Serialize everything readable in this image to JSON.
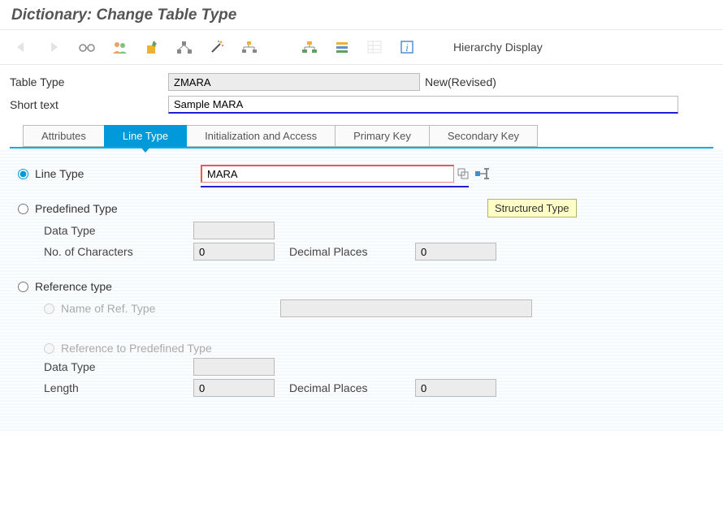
{
  "title": "Dictionary: Change Table Type",
  "toolbar": {
    "hierarchy_label": "Hierarchy Display"
  },
  "header": {
    "table_type_label": "Table Type",
    "table_type_value": "ZMARA",
    "status_text": "New(Revised)",
    "short_text_label": "Short text",
    "short_text_value": "Sample MARA"
  },
  "tabs": {
    "attributes": "Attributes",
    "line_type": "Line Type",
    "init_access": "Initialization and Access",
    "primary_key": "Primary Key",
    "secondary_key": "Secondary Key"
  },
  "form": {
    "line_type_label": "Line Type",
    "line_type_value": "MARA",
    "tooltip": "Structured Type",
    "predefined_label": "Predefined Type",
    "data_type_label": "Data Type",
    "data_type_value": "",
    "num_chars_label": "No. of Characters",
    "num_chars_value": "0",
    "decimal_label": "Decimal Places",
    "decimal_value": "0",
    "reference_label": "Reference type",
    "ref_name_label": "Name of Ref. Type",
    "ref_name_value": "",
    "ref_predef_label": "Reference to Predefined Type",
    "ref_data_type_label": "Data Type",
    "ref_data_type_value": "",
    "length_label": "Length",
    "length_value": "0",
    "ref_decimal_value": "0"
  }
}
